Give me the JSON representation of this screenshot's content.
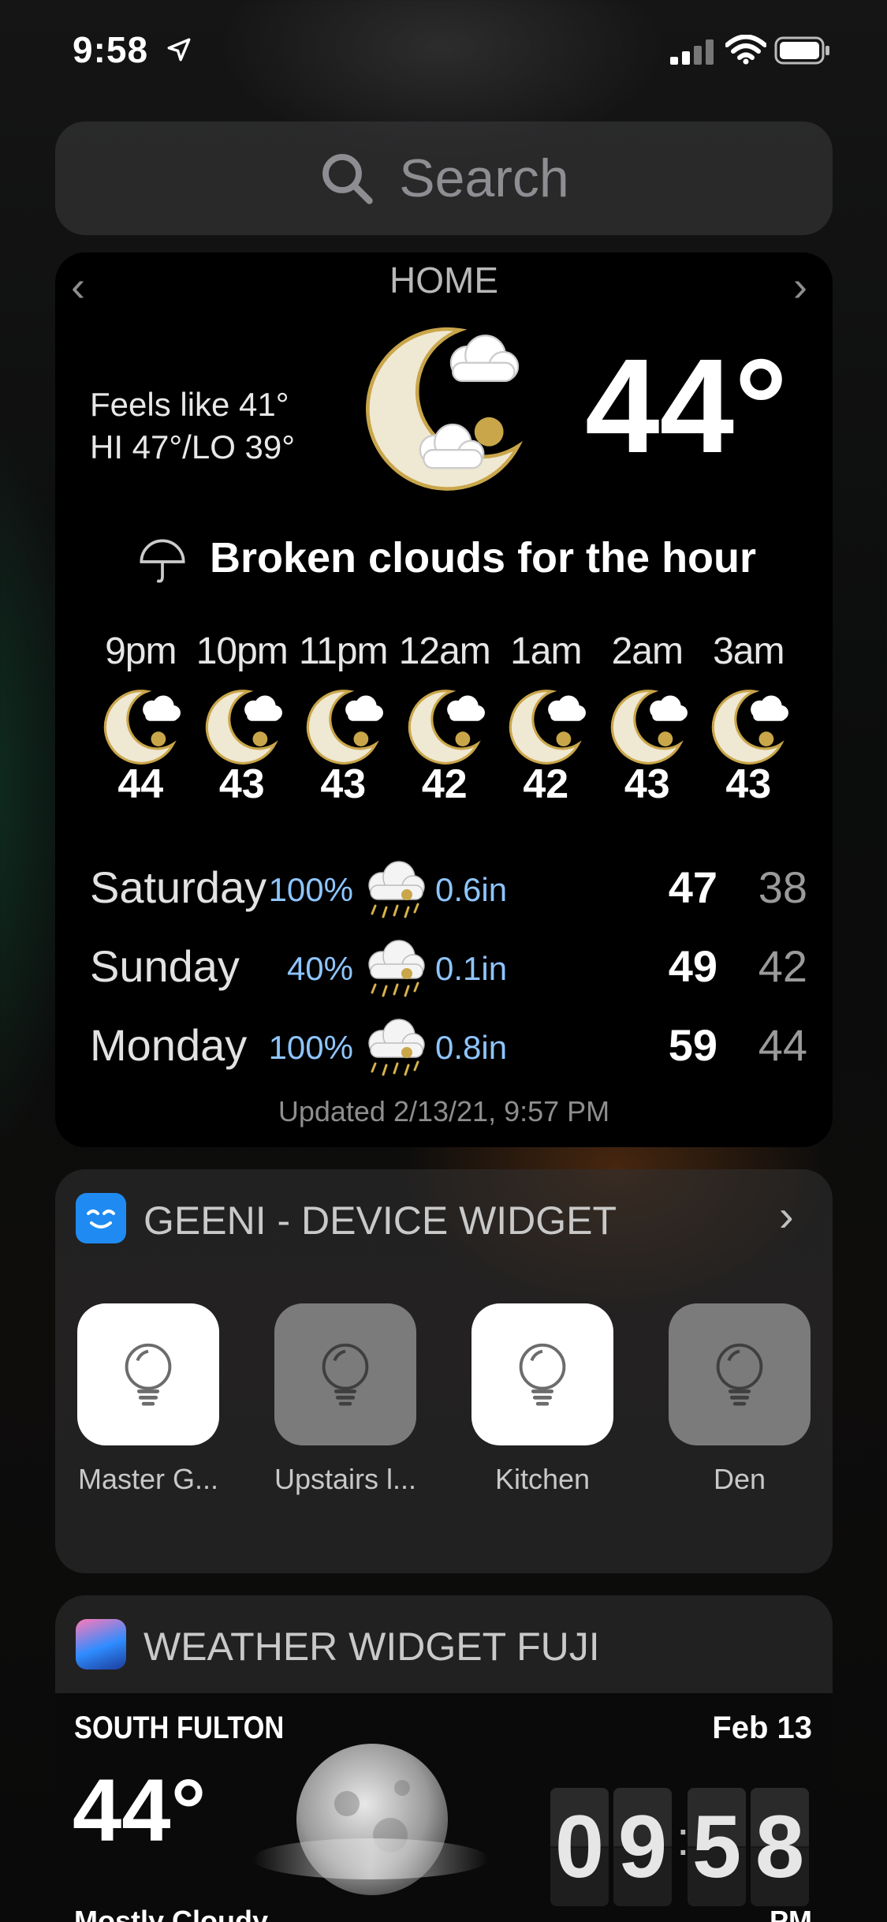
{
  "status_bar": {
    "time": "9:58"
  },
  "search": {
    "placeholder": "Search"
  },
  "weather": {
    "location": "HOME",
    "feels_like": "Feels like 41°",
    "hi_lo": "HI 47°/LO 39°",
    "current_temp": "44°",
    "summary": "Broken clouds for the hour",
    "hourly": [
      {
        "time": "9pm",
        "temp": "44"
      },
      {
        "time": "10pm",
        "temp": "43"
      },
      {
        "time": "11pm",
        "temp": "43"
      },
      {
        "time": "12am",
        "temp": "42"
      },
      {
        "time": "1am",
        "temp": "42"
      },
      {
        "time": "2am",
        "temp": "43"
      },
      {
        "time": "3am",
        "temp": "43"
      }
    ],
    "daily": [
      {
        "day": "Saturday",
        "chance": "100%",
        "rain": "0.6in",
        "hi": "47",
        "lo": "38"
      },
      {
        "day": "Sunday",
        "chance": "40%",
        "rain": "0.1in",
        "hi": "49",
        "lo": "42"
      },
      {
        "day": "Monday",
        "chance": "100%",
        "rain": "0.8in",
        "hi": "59",
        "lo": "44"
      }
    ],
    "updated": "Updated 2/13/21, 9:57 PM"
  },
  "geeni": {
    "title": "GEENI - DEVICE WIDGET",
    "devices": [
      {
        "label": "Master G...",
        "state": "on"
      },
      {
        "label": "Upstairs l...",
        "state": "off"
      },
      {
        "label": "Kitchen",
        "state": "on"
      },
      {
        "label": "Den",
        "state": "off"
      }
    ]
  },
  "fuji": {
    "title": "WEATHER WIDGET FUJI",
    "city": "SOUTH FULTON",
    "date": "Feb 13",
    "temp": "44°",
    "condition": "Mostly Cloudy",
    "clock": [
      "0",
      "9",
      "5",
      "8"
    ],
    "ampm": "PM"
  },
  "colors": {
    "precip_blue": "#8ec5ff",
    "geeni_blue": "#1f8bf2"
  }
}
